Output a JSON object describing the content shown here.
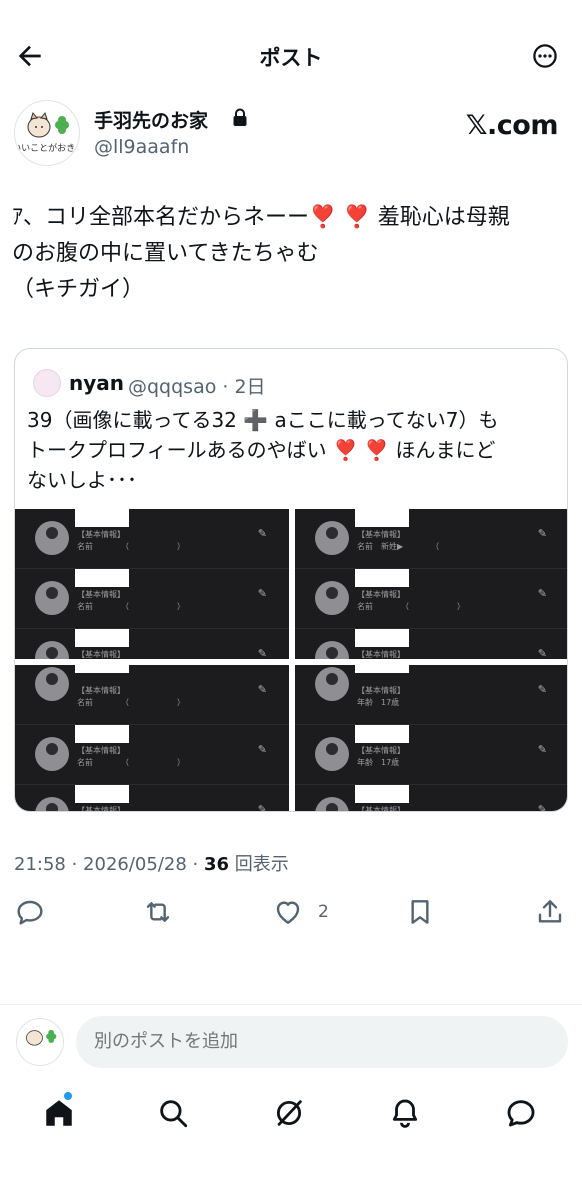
{
  "header": {
    "title": "ポスト"
  },
  "author": {
    "name": "手羽先のお家",
    "handle": "@ll9aaafn",
    "avatar_text": "いいことがおきる",
    "source_badge": "𝕏.com"
  },
  "post": {
    "text": "ｱ、コリ全部本名だからネーー❣️ ❣️ 羞恥心は母親\nのお腹の中に置いてきたちゃむ\n（キチガイ）"
  },
  "quote": {
    "name": "nyan",
    "meta": "@qqqsao · 2日",
    "text": "39（画像に載ってる32 ➕ aここに載ってない7）も\nトークプロフィールあるのやばい ❣️ ❣️ ほんまにど\nないしよ･･･",
    "media_rows": {
      "label": "【基本情報】",
      "name_line": "名前　　　　（　　　　　　）",
      "name_line_b": "名前　新姓▶　　　　（",
      "age_line": "年齢　17歳"
    }
  },
  "meta": {
    "time": "21:58 · 2026/05/28 · ",
    "views_count": "36",
    "views_label": " 回表示"
  },
  "actions": {
    "like_count": "2"
  },
  "reply": {
    "placeholder": "別のポストを追加"
  },
  "colors": {
    "accent": "#1d9bf0",
    "text": "#0f1419",
    "muted": "#536471"
  }
}
